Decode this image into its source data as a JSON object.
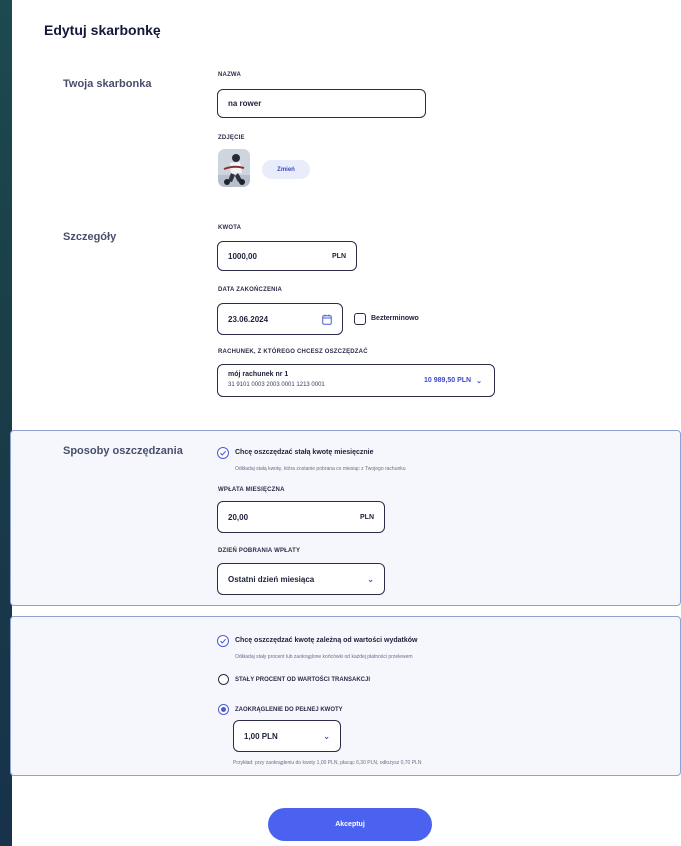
{
  "page": {
    "title": "Edytuj skarbonkę"
  },
  "sections": {
    "piggy": "Twoja skarbonka",
    "details": "Szczegóły",
    "saving_methods": "Sposoby oszczędzania"
  },
  "piggy": {
    "name_label": "NAZWA",
    "name_value": "na rower",
    "photo_label": "ZDJĘCIE",
    "change_button": "Zmień"
  },
  "details": {
    "amount_label": "KWOTA",
    "amount_value": "1000,00",
    "amount_unit": "PLN",
    "end_date_label": "DATA ZAKOŃCZENIA",
    "end_date_value": "23.06.2024",
    "indefinite_label": "Bezterminowo",
    "account_label": "RACHUNEK, Z KTÓREGO CHCESZ OSZCZĘDZAĆ",
    "account_name": "mój rachunek nr 1",
    "account_number": "31 9101 0003 2003 0001 1213 0001",
    "account_balance": "10 989,50 PLN"
  },
  "monthly": {
    "checkbox_label": "Chcę oszczędzać stałą kwotę miesięcznie",
    "description": "Odkładaj stałą kwotę, która zostanie pobrana co miesiąc z Twojego rachunku",
    "payment_label": "WPŁATA MIESIĘCZNA",
    "payment_value": "20,00",
    "payment_unit": "PLN",
    "day_label": "DZIEŃ POBRANIA WPŁATY",
    "day_value": "Ostatni dzień miesiąca"
  },
  "expenses": {
    "checkbox_label": "Chcę oszczędzać kwotę zależną od wartości wydatków",
    "description": "Odkładaj stały procent lub zaokrąglone końcówki od każdej płatności przelewem",
    "option_percent": "STAŁY PROCENT OD WARTOŚCI TRANSAKCJI",
    "option_round": "ZAOKRĄGLENIE DO PEŁNEJ KWOTY",
    "round_value": "1,00 PLN",
    "example": "Przykład: przy zaokrągleniu do kwoty 1,00 PLN, płacąc 6,30 PLN, odłożysz 0,70 PLN"
  },
  "actions": {
    "accept": "Akceptuj"
  },
  "colors": {
    "accent": "#4a62ef",
    "section_border": "#8fa1cf",
    "section_bg": "#f5f7fd"
  }
}
